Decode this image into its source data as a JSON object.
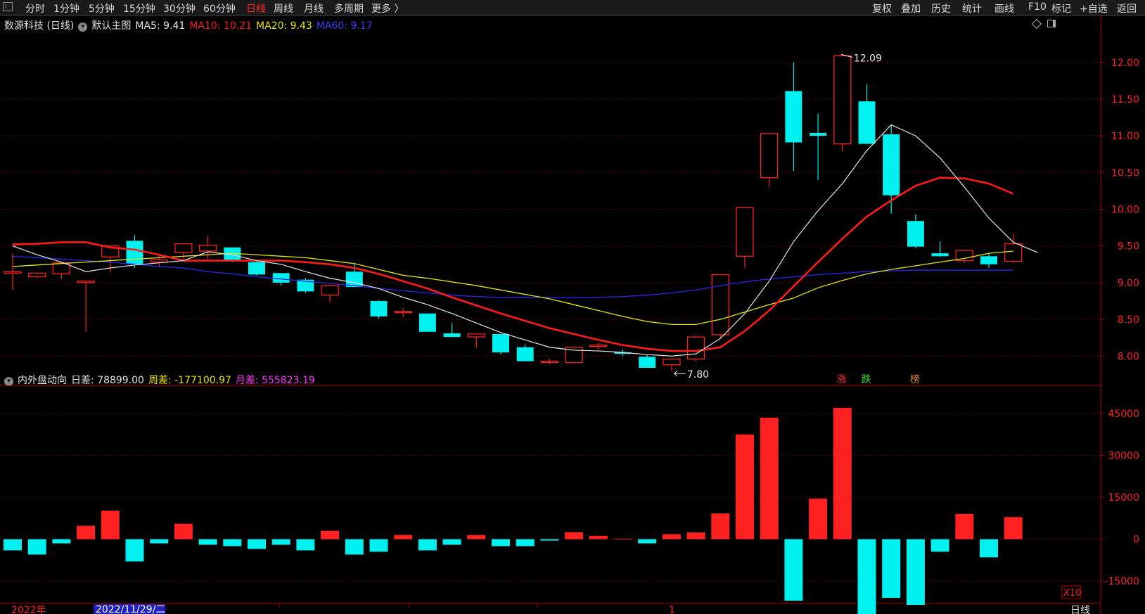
{
  "toolbar": {
    "left": [
      "分时",
      "1分钟",
      "5分钟",
      "15分钟",
      "30分钟",
      "60分钟",
      "日线",
      "周线",
      "月线",
      "多周期",
      "更多 〉"
    ],
    "active": "日线",
    "right": [
      "复权",
      "叠加",
      "历史",
      "统计",
      "画线",
      "F10",
      "标记",
      "+自选",
      "返回"
    ]
  },
  "main_legend": {
    "stock": "数源科技 (日线)",
    "main_chart": "默认主图",
    "ma5": "MA5: 9.41",
    "ma10": "MA10: 10.21",
    "ma20": "MA20: 9.43",
    "ma60": "MA60: 9.17"
  },
  "sub_legend": {
    "name": "内外盘动向",
    "daily": "日差: 78899.00",
    "weekly": "周差: -177100.97",
    "monthly": "月差: 555823.19"
  },
  "annotations": {
    "high": "12.09",
    "low": "7.80",
    "zhang": "涨",
    "die": "跌",
    "bang": "榜"
  },
  "x_axis": {
    "year": "2022年",
    "cursor_date": "2022/11/29/二",
    "month_mark": "1"
  },
  "y_axis": {
    "multiplier": "X10",
    "period_label": "日线"
  },
  "colors": {
    "up": "#ff2020",
    "down": "#00f0f0",
    "ma5": "#e6e6e6",
    "ma10": "#ff1a1a",
    "ma20": "#e6e600",
    "ma60": "#2424e0",
    "axis": "#b00000",
    "grid": "#5a0000"
  },
  "chart_data": [
    {
      "type": "candlestick",
      "ylim": [
        7.6,
        12.4
      ],
      "yticks": [
        8.0,
        8.5,
        9.0,
        9.5,
        10.0,
        10.5,
        11.0,
        11.5,
        12.0
      ],
      "ytick_labels": [
        "8.00",
        "8.50",
        "9.00",
        "9.50",
        "10.00",
        "10.50",
        "11.00",
        "11.50",
        "12.00"
      ],
      "candles": [
        [
          9.15,
          9.4,
          8.9,
          9.15
        ],
        [
          9.08,
          9.13,
          9.06,
          9.13
        ],
        [
          9.12,
          9.27,
          9.05,
          9.27
        ],
        [
          9.01,
          9.02,
          8.33,
          9.02
        ],
        [
          9.35,
          9.5,
          9.14,
          9.5
        ],
        [
          9.57,
          9.65,
          9.2,
          9.25
        ],
        [
          9.28,
          9.38,
          9.22,
          9.31
        ],
        [
          9.41,
          9.53,
          9.32,
          9.53
        ],
        [
          9.43,
          9.64,
          9.32,
          9.51
        ],
        [
          9.48,
          9.48,
          9.28,
          9.31
        ],
        [
          9.28,
          9.3,
          9.1,
          9.11
        ],
        [
          9.13,
          9.13,
          8.96,
          9.0
        ],
        [
          9.04,
          9.06,
          8.86,
          8.88
        ],
        [
          8.83,
          8.96,
          8.73,
          8.96
        ],
        [
          9.15,
          9.27,
          8.94,
          8.94
        ],
        [
          8.75,
          8.76,
          8.51,
          8.54
        ],
        [
          8.6,
          8.65,
          8.53,
          8.61
        ],
        [
          8.58,
          8.58,
          8.33,
          8.33
        ],
        [
          8.31,
          8.45,
          8.26,
          8.26
        ],
        [
          8.26,
          8.31,
          8.11,
          8.3
        ],
        [
          8.3,
          8.3,
          8.02,
          8.05
        ],
        [
          8.12,
          8.16,
          7.93,
          7.93
        ],
        [
          7.91,
          7.96,
          7.89,
          7.93
        ],
        [
          7.91,
          8.12,
          7.91,
          8.12
        ],
        [
          8.15,
          8.18,
          8.09,
          8.15
        ],
        [
          8.05,
          8.09,
          8.0,
          8.03
        ],
        [
          7.99,
          8.02,
          7.84,
          7.84
        ],
        [
          7.88,
          7.96,
          7.8,
          7.96
        ],
        [
          7.96,
          8.28,
          7.93,
          8.26
        ],
        [
          8.29,
          9.11,
          8.25,
          9.11
        ],
        [
          9.36,
          10.02,
          9.2,
          10.02
        ],
        [
          10.43,
          11.03,
          10.3,
          11.03
        ],
        [
          11.61,
          12.0,
          10.52,
          10.91
        ],
        [
          11.04,
          11.3,
          10.4,
          11.0
        ],
        [
          10.89,
          12.09,
          10.79,
          12.09
        ],
        [
          11.47,
          11.7,
          10.89,
          10.89
        ],
        [
          11.02,
          11.15,
          9.94,
          10.19
        ],
        [
          9.84,
          9.93,
          9.47,
          9.49
        ],
        [
          9.4,
          9.56,
          9.35,
          9.36
        ],
        [
          9.3,
          9.44,
          9.27,
          9.44
        ],
        [
          9.36,
          9.4,
          9.2,
          9.25
        ],
        [
          9.29,
          9.67,
          9.27,
          9.53
        ]
      ],
      "ma5": [
        9.5,
        9.38,
        9.28,
        9.15,
        9.2,
        9.24,
        9.27,
        9.3,
        9.42,
        9.38,
        9.3,
        9.25,
        9.15,
        9.06,
        9.0,
        8.92,
        8.8,
        8.7,
        8.58,
        8.45,
        8.32,
        8.22,
        8.12,
        8.08,
        8.07,
        8.05,
        8.02,
        8.0,
        8.03,
        8.24,
        8.58,
        9.02,
        9.56,
        9.98,
        10.35,
        10.8,
        11.15,
        11.0,
        10.7,
        10.3,
        9.88,
        9.55,
        9.41
      ],
      "ma10": [
        9.52,
        9.53,
        9.55,
        9.55,
        9.48,
        9.45,
        9.38,
        9.3,
        9.3,
        9.3,
        9.3,
        9.3,
        9.28,
        9.25,
        9.2,
        9.12,
        9.02,
        8.92,
        8.8,
        8.69,
        8.58,
        8.48,
        8.38,
        8.3,
        8.22,
        8.15,
        8.1,
        8.07,
        8.07,
        8.12,
        8.34,
        8.62,
        8.95,
        9.28,
        9.6,
        9.9,
        10.12,
        10.32,
        10.43,
        10.42,
        10.35,
        10.21
      ],
      "ma20": [
        9.22,
        9.24,
        9.26,
        9.28,
        9.3,
        9.32,
        9.34,
        9.36,
        9.38,
        9.4,
        9.38,
        9.36,
        9.34,
        9.3,
        9.26,
        9.18,
        9.1,
        9.06,
        9.01,
        8.96,
        8.9,
        8.84,
        8.78,
        8.7,
        8.62,
        8.54,
        8.47,
        8.43,
        8.43,
        8.5,
        8.6,
        8.7,
        8.79,
        8.93,
        9.03,
        9.12,
        9.18,
        9.23,
        9.28,
        9.33,
        9.4,
        9.43
      ],
      "ma60": [
        9.36,
        9.34,
        9.32,
        9.3,
        9.28,
        9.25,
        9.22,
        9.2,
        9.15,
        9.12,
        9.08,
        9.05,
        9.02,
        8.99,
        8.96,
        8.92,
        8.89,
        8.86,
        8.83,
        8.81,
        8.8,
        8.8,
        8.8,
        8.8,
        8.8,
        8.81,
        8.83,
        8.86,
        8.9,
        8.96,
        9.01,
        9.05,
        9.08,
        9.11,
        9.13,
        9.15,
        9.16,
        9.17,
        9.17,
        9.17,
        9.17,
        9.17
      ]
    },
    {
      "type": "bar",
      "ylim": [
        -23000,
        52000
      ],
      "yticks": [
        -15000,
        0,
        15000,
        30000,
        45000
      ],
      "ytick_labels": [
        "-15000",
        "0",
        "15000",
        "30000",
        "45000"
      ],
      "values": [
        -4000,
        -5500,
        -1500,
        4800,
        10200,
        -8000,
        -1500,
        5500,
        -2000,
        -2500,
        -3500,
        -2000,
        -4000,
        3000,
        -5500,
        -4500,
        1500,
        -4000,
        -2000,
        1500,
        -2500,
        -2500,
        -500,
        2500,
        1200,
        200,
        -1500,
        1800,
        2400,
        9200,
        37500,
        43500,
        -22000,
        14500,
        47000,
        -37000,
        -21000,
        -23500,
        -4500,
        9000,
        -6500,
        7900
      ]
    }
  ]
}
